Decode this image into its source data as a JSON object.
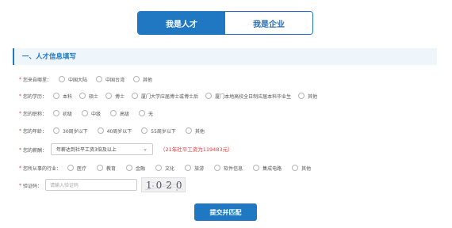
{
  "tabs": [
    {
      "label": "我是人才"
    },
    {
      "label": "我是企业"
    }
  ],
  "section": {
    "title": "一、人才信息填写"
  },
  "req_mark": "*",
  "fields": {
    "origin": {
      "label": "您来自哪里：",
      "options": [
        "中国大陆",
        "中国台湾",
        "其他"
      ]
    },
    "education": {
      "label": "您的学历：",
      "options": [
        "本科",
        "硕士",
        "博士",
        "厦门大学应届博士或博士后",
        "厦门本地高校全日制应届本科毕业生",
        "其他"
      ]
    },
    "title": {
      "label": "您的职称：",
      "options": [
        "初级",
        "中级",
        "高级",
        "无"
      ]
    },
    "age": {
      "label": "您的年龄：",
      "options": [
        "30周岁以下",
        "40周岁以下",
        "55周岁以下",
        "其他"
      ]
    },
    "salary": {
      "label": "您的薪酬：",
      "selected": "年薪达到社平工资3倍及以上",
      "note": "（21年社平工资为119483元）"
    },
    "industry": {
      "label": "您所从事的行业：",
      "options": [
        "医疗",
        "教育",
        "金融",
        "文化",
        "旅游",
        "软件信息",
        "集成电路",
        "其他"
      ]
    },
    "captcha": {
      "label": "验证码：",
      "placeholder": "请输入验证码",
      "code": "1020"
    }
  },
  "submit_label": "提交并匹配"
}
